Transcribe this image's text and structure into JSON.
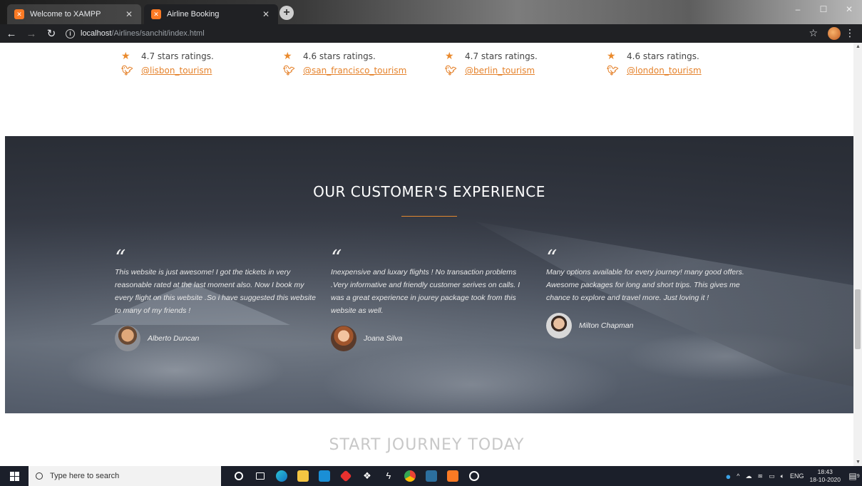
{
  "browser": {
    "tabs": [
      {
        "title": "Welcome to XAMPP",
        "favicon": "xampp-icon",
        "active": false
      },
      {
        "title": "Airline Booking",
        "favicon": "xampp-icon",
        "active": true
      }
    ],
    "url_host": "localhost",
    "url_path": "/Airlines/sanchit/index.html"
  },
  "stats": [
    {
      "rating": "4.7 stars ratings.",
      "handle": "@lisbon_tourism"
    },
    {
      "rating": "4.6 stars ratings.",
      "handle": "@san_francisco_tourism"
    },
    {
      "rating": "4.7 stars ratings.",
      "handle": "@berlin_tourism"
    },
    {
      "rating": "4.6 stars ratings.",
      "handle": "@london_tourism"
    }
  ],
  "testimonials_section": {
    "title": "OUR CUSTOMER'S EXPERIENCE",
    "accent_color": "#e3882f",
    "quote_mark": "“",
    "items": [
      {
        "text": "This website is just awesome! I got the tickets in very reasonable rated at the last moment also. Now I book my every flight on this website .So i have suggested this website to many of my friends !",
        "author": "Alberto Duncan"
      },
      {
        "text": "Inexpensive and luxary flights ! No transaction problems .Very informative and friendly customer serives on calls. I was a great experience in jourey package took from this website as well.",
        "author": "Joana Silva"
      },
      {
        "text": "Many options available for every journey! many good offers. Awesome packages for long and short trips. This gives me chance to explore and travel more. Just loving it !",
        "author": "Milton Chapman"
      }
    ]
  },
  "next_section_heading": "START JOURNEY TODAY",
  "taskbar": {
    "search_placeholder": "Type here to search",
    "language": "ENG",
    "time": "18:43",
    "date": "18-10-2020",
    "notification_count": "9"
  }
}
